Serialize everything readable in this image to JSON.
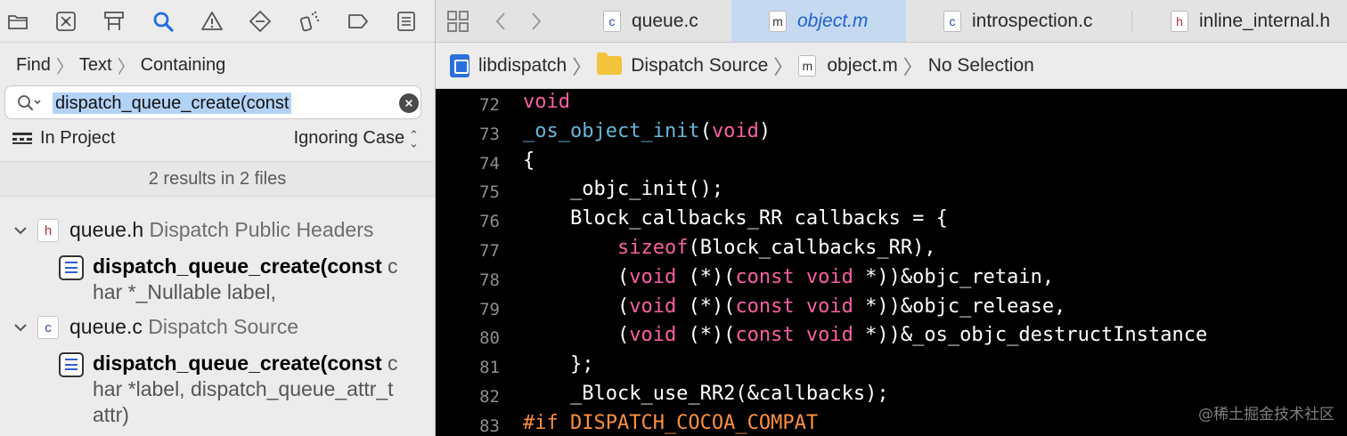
{
  "navigator": {
    "toolbar_icons": [
      "folder-icon",
      "source-control-icon",
      "symbol-hierarchy-icon",
      "search-icon",
      "warning-icon",
      "breakpoint-diamond-icon",
      "debug-spray-icon",
      "tag-icon",
      "report-list-icon"
    ],
    "find_path": [
      "Find",
      "Text",
      "Containing"
    ],
    "search": {
      "value": "dispatch_queue_create(const"
    },
    "scope": {
      "label": "In Project",
      "case_label": "Ignoring Case"
    },
    "results_summary": "2 results in 2 files",
    "results": [
      {
        "file_type": "h",
        "file_name": "queue.h",
        "group": "Dispatch Public Headers",
        "match_bold": "dispatch_queue_create(const",
        "match_rest": " char *_Nullable label,"
      },
      {
        "file_type": "c",
        "file_name": "queue.c",
        "group": "Dispatch Source",
        "match_bold": "dispatch_queue_create(const",
        "match_rest": " char *label, dispatch_queue_attr_t attr)"
      }
    ]
  },
  "editor": {
    "tabs": [
      {
        "type": "c",
        "label": "queue.c",
        "active": false
      },
      {
        "type": "m",
        "label": "object.m",
        "active": true
      },
      {
        "type": "c",
        "label": "introspection.c",
        "active": false
      },
      {
        "type": "h",
        "label": "inline_internal.h",
        "active": false
      }
    ],
    "jumpbar": {
      "project": "libdispatch",
      "folder": "Dispatch Source",
      "file": "object.m",
      "selection": "No Selection"
    },
    "accent_keyword": "#fc5fa3",
    "accent_function": "#67b7d8",
    "accent_preprocessor": "#fd8f3f",
    "lines": [
      {
        "num": "72",
        "tokens": [
          [
            "kw",
            "void"
          ]
        ]
      },
      {
        "num": "73",
        "tokens": [
          [
            "fn",
            "_os_object_init"
          ],
          [
            "",
            "("
          ],
          [
            "kw",
            "void"
          ],
          [
            "",
            ")"
          ]
        ]
      },
      {
        "num": "74",
        "tokens": [
          [
            "",
            "{"
          ]
        ]
      },
      {
        "num": "75",
        "tokens": [
          [
            "",
            "    _objc_init();"
          ]
        ]
      },
      {
        "num": "76",
        "tokens": [
          [
            "",
            "    Block_callbacks_RR callbacks = {"
          ]
        ]
      },
      {
        "num": "77",
        "tokens": [
          [
            "",
            "        "
          ],
          [
            "kw",
            "sizeof"
          ],
          [
            "",
            "(Block_callbacks_RR),"
          ]
        ]
      },
      {
        "num": "78",
        "tokens": [
          [
            "",
            "        ("
          ],
          [
            "kw",
            "void"
          ],
          [
            "",
            " (*)("
          ],
          [
            "kw",
            "const"
          ],
          [
            "",
            " "
          ],
          [
            "kw",
            "void"
          ],
          [
            "",
            " *))&objc_retain,"
          ]
        ]
      },
      {
        "num": "79",
        "tokens": [
          [
            "",
            "        ("
          ],
          [
            "kw",
            "void"
          ],
          [
            "",
            " (*)("
          ],
          [
            "kw",
            "const"
          ],
          [
            "",
            " "
          ],
          [
            "kw",
            "void"
          ],
          [
            "",
            " *))&objc_release,"
          ]
        ]
      },
      {
        "num": "80",
        "tokens": [
          [
            "",
            "        ("
          ],
          [
            "kw",
            "void"
          ],
          [
            "",
            " (*)("
          ],
          [
            "kw",
            "const"
          ],
          [
            "",
            " "
          ],
          [
            "kw",
            "void"
          ],
          [
            "",
            " *))&_os_objc_destructInstance"
          ]
        ]
      },
      {
        "num": "81",
        "tokens": [
          [
            "",
            "    };"
          ]
        ]
      },
      {
        "num": "82",
        "tokens": [
          [
            "",
            "    _Block_use_RR2(&callbacks);"
          ]
        ]
      },
      {
        "num": "83",
        "tokens": [
          [
            "pp",
            "#if DISPATCH_COCOA_COMPAT"
          ]
        ]
      }
    ]
  },
  "watermark": "@稀土掘金技术社区"
}
